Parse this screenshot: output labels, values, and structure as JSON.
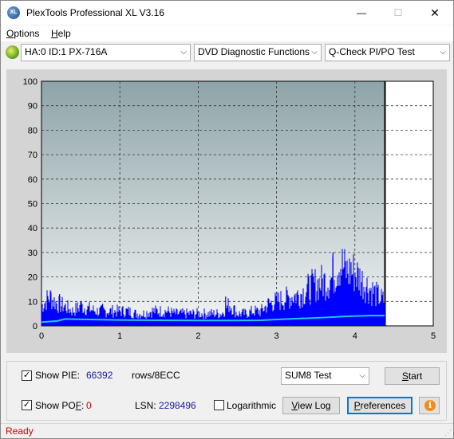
{
  "window": {
    "title": "PlexTools Professional XL V3.16",
    "app_icon_text": "XL",
    "minimize_glyph": "—",
    "maximize_glyph": "☐",
    "close_glyph": "✕"
  },
  "menu": {
    "options_first": "O",
    "options_rest": "ptions",
    "help_first": "H",
    "help_rest": "elp"
  },
  "toolbar": {
    "drive": "HA:0 ID:1  PX-716A",
    "function": "DVD Diagnostic Functions",
    "test": "Q-Check PI/PO Test",
    "arrow": "⌵"
  },
  "chart_data": {
    "type": "bar",
    "title": "",
    "xlabel": "",
    "ylabel": "",
    "xlim": [
      0,
      5
    ],
    "ylim": [
      0,
      100
    ],
    "x_ticks": [
      "0",
      "1",
      "2",
      "3",
      "4",
      "5"
    ],
    "y_ticks": [
      "0",
      "10",
      "20",
      "30",
      "40",
      "50",
      "60",
      "70",
      "80",
      "90",
      "100"
    ],
    "grid": true,
    "data_end_x": 4.38,
    "series": [
      {
        "role": "PI errors",
        "color": "#0000ff",
        "x": [
          0.0,
          0.1,
          0.2,
          0.3,
          0.4,
          0.5,
          0.6,
          0.7,
          0.8,
          0.9,
          1.0,
          1.1,
          1.2,
          1.3,
          1.4,
          1.5,
          1.6,
          1.7,
          1.8,
          1.9,
          2.0,
          2.1,
          2.2,
          2.3,
          2.4,
          2.5,
          2.6,
          2.7,
          2.8,
          2.9,
          3.0,
          3.1,
          3.2,
          3.3,
          3.4,
          3.5,
          3.6,
          3.7,
          3.8,
          3.9,
          4.0,
          4.1,
          4.2,
          4.3,
          4.38
        ],
        "values": [
          8,
          12,
          9,
          8,
          6,
          8,
          7,
          6,
          6,
          6,
          6,
          6,
          5,
          5,
          6,
          6,
          6,
          5,
          5,
          5,
          5,
          5,
          5,
          5,
          9,
          5,
          5,
          6,
          6,
          9,
          10,
          11,
          12,
          13,
          15,
          17,
          18,
          19,
          26,
          22,
          22,
          18,
          15,
          12,
          10
        ],
        "peaks": [
          [
            0.12,
            14
          ],
          [
            0.23,
            13
          ],
          [
            0.5,
            10
          ],
          [
            0.78,
            9
          ],
          [
            2.35,
            12
          ],
          [
            3.72,
            30
          ],
          [
            3.95,
            26
          ]
        ]
      },
      {
        "role": "PI 8 ECC sum",
        "color": "#20c8e8",
        "x": [
          0.0,
          0.2,
          0.3,
          0.6,
          1.0,
          1.5,
          2.0,
          2.5,
          2.8,
          3.0,
          3.3,
          3.6,
          3.9,
          4.2,
          4.38
        ],
        "values": [
          1.5,
          2,
          2.8,
          2.6,
          2.4,
          2.3,
          2.2,
          2.2,
          2.3,
          2.6,
          3.0,
          3.4,
          3.9,
          4.2,
          4.2
        ]
      }
    ]
  },
  "controls": {
    "show_pie_label": "Show PIE:",
    "show_pie_checked": "✓",
    "pie_value": "66392",
    "rows_label": "rows/8ECC",
    "show_poe_label_first": "Show PO",
    "show_poe_label_ul": "F",
    "show_poe_label_end": ":",
    "show_poe_checked": "✓",
    "poe_value": "0",
    "lsn_label": "LSN:",
    "lsn_value": "2298496",
    "logarithmic_label": "Logarithmic",
    "test_select": "SUM8 Test",
    "start_first": "S",
    "start_rest": "tart",
    "viewlog_first": "V",
    "viewlog_rest": "iew Log",
    "preferences_first": "P",
    "preferences_rest": "references",
    "info_glyph": "i"
  },
  "status": {
    "text": "Ready"
  }
}
